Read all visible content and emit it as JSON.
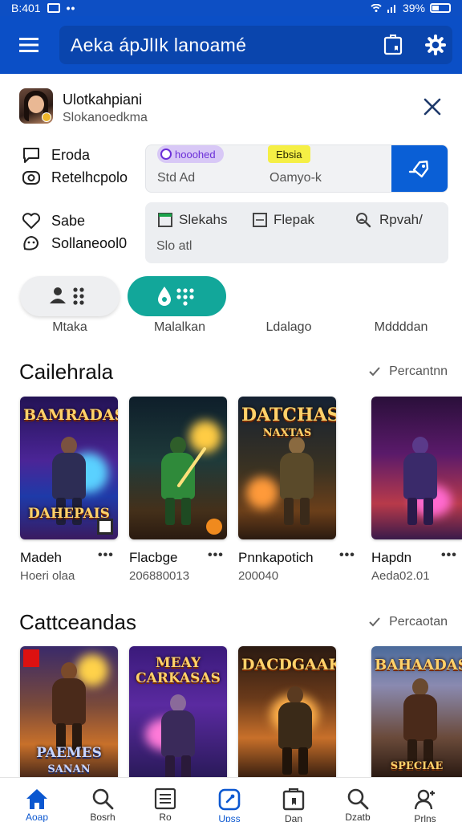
{
  "status_bar": {
    "time": "B:401",
    "battery": "39%"
  },
  "app_bar": {
    "title": "Aeka ápJlIk lanoamé"
  },
  "profile": {
    "name": "Ulotkahpiani",
    "subtitle": "Slokanoedkma"
  },
  "info": [
    {
      "label": "Eroda",
      "icon": "chat-icon"
    },
    {
      "label": "Retelhcpolo",
      "icon": "camera-icon"
    },
    {
      "label": "Sabe",
      "icon": "heart-icon"
    },
    {
      "label": "Sollaneool0",
      "icon": "smile-icon"
    }
  ],
  "card1": {
    "pill_purple": "hooohed",
    "pill_yellow": "Ebsia",
    "text_left": "Std Ad",
    "text_right": "Oamyo-k"
  },
  "card2": {
    "options": [
      "Slekahs",
      "Flepak",
      "Rpvah/"
    ],
    "subtitle": "Slo atl"
  },
  "chips": [
    "Mtaka",
    "Malalkan",
    "Ldalago",
    "Mddddan"
  ],
  "sections": [
    {
      "title": "Cailehrala",
      "link": "Percantnn"
    },
    {
      "title": "Cattceandas",
      "link": "Percaotan"
    }
  ],
  "games_row1": [
    {
      "art_title": "BAMRADAS",
      "art_sub": "DAHEPAIS",
      "name": "Madeh",
      "meta": "Hoeri olaa"
    },
    {
      "art_title": "",
      "art_sub": "",
      "name": "Flacbge",
      "meta": "206880013"
    },
    {
      "art_title": "DATCHASK",
      "art_sub": "NAXTAS",
      "name": "Pnnkapotich",
      "meta": "200040"
    },
    {
      "art_title": "",
      "art_sub": "",
      "name": "Hapdn",
      "meta": "Aeda02.01"
    }
  ],
  "games_row2": [
    {
      "art_title": "",
      "art_sub": "PAEMES",
      "art_sub2": "SANAN"
    },
    {
      "art_title": "MEAY CARKASAS",
      "art_sub": ""
    },
    {
      "art_title": "DACDGAAK",
      "art_sub": ""
    },
    {
      "art_title": "BAHAADASK",
      "art_sub": "SPECIAE"
    }
  ],
  "bottom_nav": [
    {
      "label": "Aoap",
      "icon": "home-icon"
    },
    {
      "label": "Bosrh",
      "icon": "search-icon"
    },
    {
      "label": "Ro",
      "icon": "list-icon"
    },
    {
      "label": "Upss",
      "icon": "apps-icon"
    },
    {
      "label": "Dan",
      "icon": "store-icon"
    },
    {
      "label": "Dzatb",
      "icon": "search-icon"
    },
    {
      "label": "Prlns",
      "icon": "account-icon"
    }
  ]
}
